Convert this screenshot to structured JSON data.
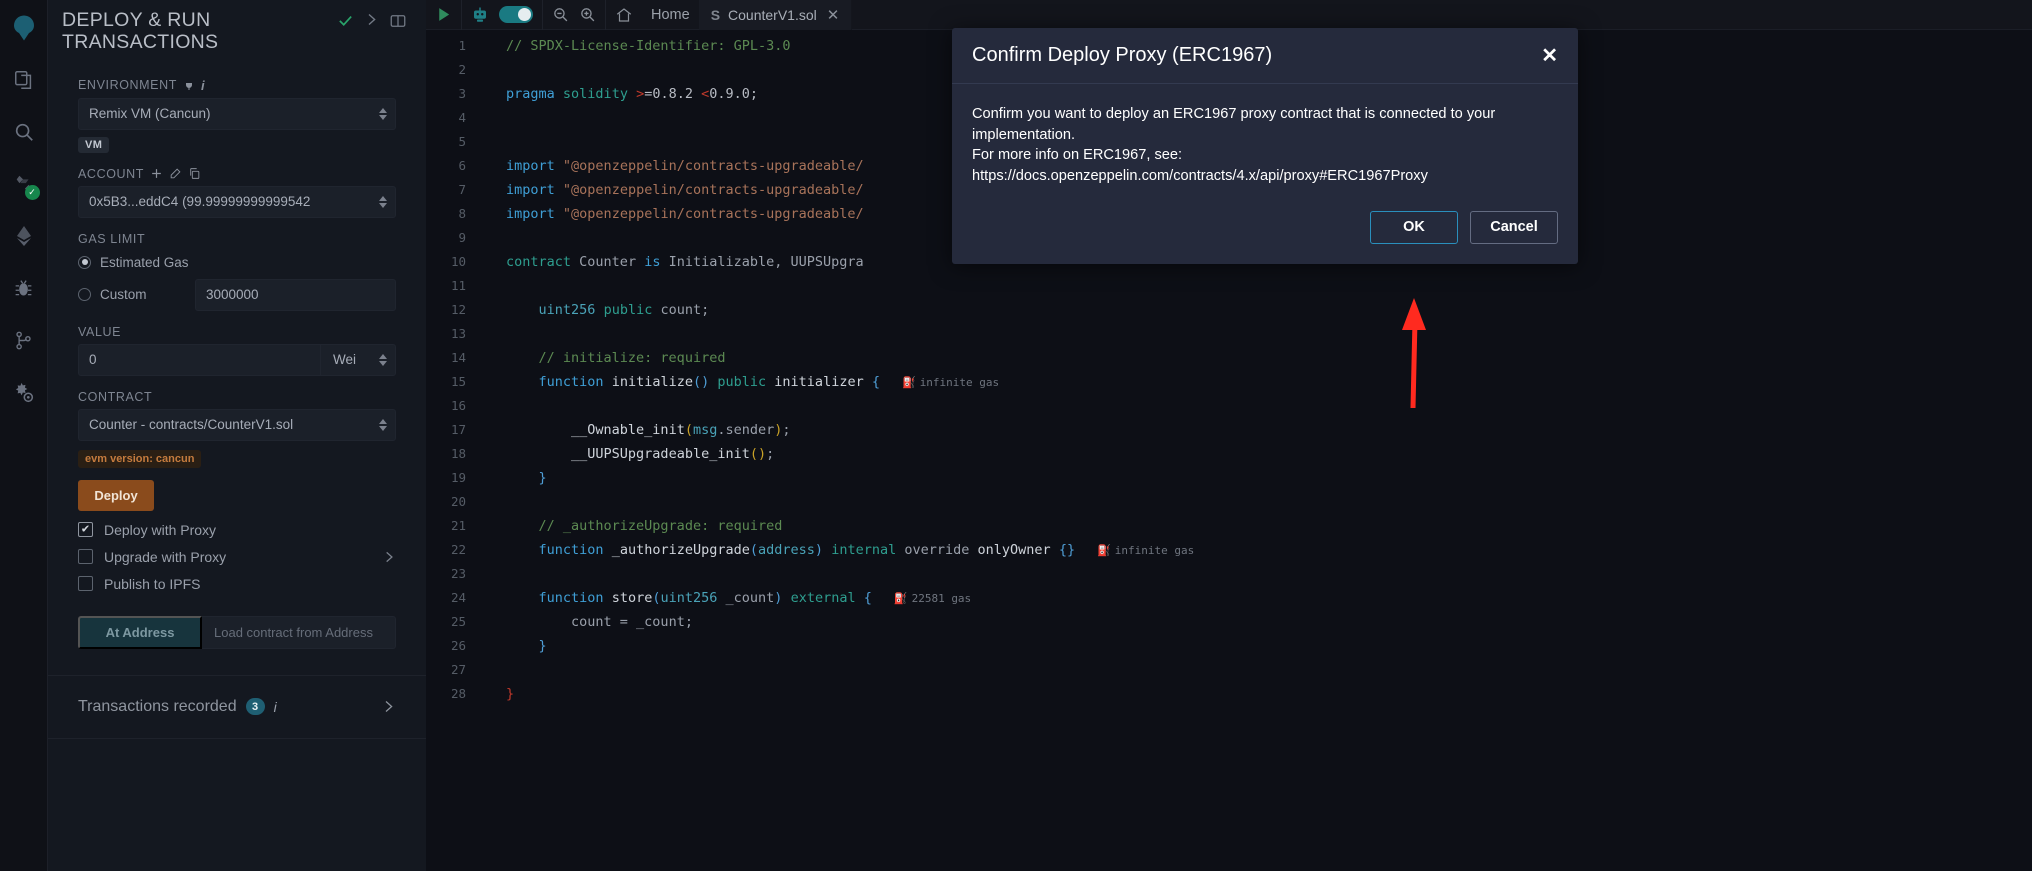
{
  "rail": {
    "items": [
      {
        "name": "remix-logo-icon",
        "label": "Remix"
      },
      {
        "name": "file-explorer-icon",
        "label": "File explorer"
      },
      {
        "name": "search-icon",
        "label": "Search in files"
      },
      {
        "name": "solidity-compiler-icon",
        "label": "Solidity compiler"
      },
      {
        "name": "deploy-run-icon",
        "label": "Deploy & run transactions"
      },
      {
        "name": "debugger-icon",
        "label": "Debugger"
      },
      {
        "name": "git-icon",
        "label": "Git"
      },
      {
        "name": "plugin-manager-icon",
        "label": "Plugin manager"
      }
    ]
  },
  "panel": {
    "title": "DEPLOY & RUN TRANSACTIONS",
    "header_controls": [
      {
        "name": "check-icon",
        "label": "✓"
      },
      {
        "name": "chevron-right-icon",
        "label": "›"
      },
      {
        "name": "layout-panel-icon",
        "label": "▣"
      }
    ],
    "environment": {
      "label": "ENVIRONMENT",
      "value": "Remix VM (Cancun)",
      "chip": "VM"
    },
    "account": {
      "label": "ACCOUNT",
      "value": "0x5B3...eddC4 (99.99999999999542",
      "actions": [
        "plus-icon",
        "edit-icon",
        "copy-icon"
      ]
    },
    "gas_limit": {
      "label": "GAS LIMIT",
      "estimated_label": "Estimated Gas",
      "custom_label": "Custom",
      "custom_value": "3000000",
      "selected": "Estimated Gas"
    },
    "value": {
      "label": "VALUE",
      "amount": "0",
      "unit": "Wei"
    },
    "contract": {
      "label": "CONTRACT",
      "value": "Counter - contracts/CounterV1.sol",
      "evm_chip": "evm version: cancun"
    },
    "deploy_label": "Deploy",
    "options": [
      {
        "label": "Deploy with Proxy",
        "checked": true,
        "chevron": false
      },
      {
        "label": "Upgrade with Proxy",
        "checked": false,
        "chevron": true
      },
      {
        "label": "Publish to IPFS",
        "checked": false,
        "chevron": false
      }
    ],
    "at_address": {
      "button_label": "At Address",
      "placeholder": "Load contract from Address"
    },
    "transactions": {
      "label": "Transactions recorded",
      "count": "3",
      "info": "i",
      "chevron": "›"
    }
  },
  "toolbar": {
    "run_label": "▶",
    "bot_label": "robot",
    "zoom_out_label": "−",
    "zoom_in_label": "+",
    "home_label": "Home"
  },
  "tabs": [
    {
      "label": "CounterV1.sol",
      "icon": "solidity-icon",
      "close": "✕",
      "active": true
    }
  ],
  "code": {
    "lines": [
      {
        "n": "1",
        "segs": [
          {
            "t": "// SPDX-License-Identifier: GPL-3.0",
            "c": "c-comment"
          }
        ]
      },
      {
        "n": "2",
        "segs": []
      },
      {
        "n": "3",
        "segs": [
          {
            "t": "pragma",
            "c": "c-key"
          },
          {
            "t": " ",
            "c": "c-punct"
          },
          {
            "t": "solidity",
            "c": "c-key2"
          },
          {
            "t": " ",
            "c": "c-punct"
          },
          {
            "t": ">",
            "c": "c-red"
          },
          {
            "t": "=0.8.2 ",
            "c": "c-num"
          },
          {
            "t": "<",
            "c": "c-red"
          },
          {
            "t": "0.9.0;",
            "c": "c-num"
          }
        ]
      },
      {
        "n": "4",
        "segs": []
      },
      {
        "n": "5",
        "segs": []
      },
      {
        "n": "6",
        "segs": [
          {
            "t": "import",
            "c": "c-key"
          },
          {
            "t": " ",
            "c": "c-punct"
          },
          {
            "t": "\"@openzeppelin/contracts-upgradeable/",
            "c": "c-str"
          }
        ]
      },
      {
        "n": "7",
        "segs": [
          {
            "t": "import",
            "c": "c-key"
          },
          {
            "t": " ",
            "c": "c-punct"
          },
          {
            "t": "\"@openzeppelin/contracts-upgradeable/",
            "c": "c-str"
          }
        ]
      },
      {
        "n": "8",
        "segs": [
          {
            "t": "import",
            "c": "c-key"
          },
          {
            "t": " ",
            "c": "c-punct"
          },
          {
            "t": "\"@openzeppelin/contracts-upgradeable/",
            "c": "c-str"
          }
        ]
      },
      {
        "n": "9",
        "segs": []
      },
      {
        "n": "10",
        "segs": [
          {
            "t": "contract",
            "c": "c-key2"
          },
          {
            "t": " ",
            "c": "c-punct"
          },
          {
            "t": "Counter",
            "c": "c-ident"
          },
          {
            "t": " ",
            "c": "c-punct"
          },
          {
            "t": "is",
            "c": "c-key"
          },
          {
            "t": " ",
            "c": "c-punct"
          },
          {
            "t": "Initializable, UUPSUpgra",
            "c": "c-ident"
          }
        ]
      },
      {
        "n": "11",
        "segs": []
      },
      {
        "n": "12",
        "segs": [
          {
            "t": "    ",
            "c": "c-punct"
          },
          {
            "t": "uint256",
            "c": "c-teal"
          },
          {
            "t": " ",
            "c": "c-punct"
          },
          {
            "t": "public",
            "c": "c-key2"
          },
          {
            "t": " ",
            "c": "c-punct"
          },
          {
            "t": "count;",
            "c": "c-ident"
          }
        ]
      },
      {
        "n": "13",
        "segs": []
      },
      {
        "n": "14",
        "segs": [
          {
            "t": "    ",
            "c": "c-punct"
          },
          {
            "t": "// initialize: required",
            "c": "c-comment"
          }
        ]
      },
      {
        "n": "15",
        "segs": [
          {
            "t": "    ",
            "c": "c-punct"
          },
          {
            "t": "function",
            "c": "c-key"
          },
          {
            "t": " ",
            "c": "c-punct"
          },
          {
            "t": "initialize",
            "c": "c-fname"
          },
          {
            "t": "()",
            "c": "c-brace"
          },
          {
            "t": " ",
            "c": "c-punct"
          },
          {
            "t": "public",
            "c": "c-key2"
          },
          {
            "t": " ",
            "c": "c-punct"
          },
          {
            "t": "initializer",
            "c": "c-fname"
          },
          {
            "t": " ",
            "c": "c-punct"
          },
          {
            "t": "{",
            "c": "c-brace"
          }
        ],
        "gas": "infinite gas"
      },
      {
        "n": "16",
        "segs": []
      },
      {
        "n": "17",
        "segs": [
          {
            "t": "        ",
            "c": "c-punct"
          },
          {
            "t": "__Ownable_init",
            "c": "c-fname"
          },
          {
            "t": "(",
            "c": "c-yellow"
          },
          {
            "t": "msg",
            "c": "c-teal"
          },
          {
            "t": ".sender",
            "c": "c-ident"
          },
          {
            "t": ")",
            "c": "c-yellow"
          },
          {
            "t": ";",
            "c": "c-ident"
          }
        ]
      },
      {
        "n": "18",
        "segs": [
          {
            "t": "        ",
            "c": "c-punct"
          },
          {
            "t": "__UUPSUpgradeable_init",
            "c": "c-fname"
          },
          {
            "t": "()",
            "c": "c-yellow"
          },
          {
            "t": ";",
            "c": "c-ident"
          }
        ]
      },
      {
        "n": "19",
        "segs": [
          {
            "t": "    ",
            "c": "c-punct"
          },
          {
            "t": "}",
            "c": "c-brace"
          }
        ]
      },
      {
        "n": "20",
        "segs": []
      },
      {
        "n": "21",
        "segs": [
          {
            "t": "    ",
            "c": "c-punct"
          },
          {
            "t": "// _authorizeUpgrade: required",
            "c": "c-comment"
          }
        ]
      },
      {
        "n": "22",
        "segs": [
          {
            "t": "    ",
            "c": "c-punct"
          },
          {
            "t": "function",
            "c": "c-key"
          },
          {
            "t": " ",
            "c": "c-punct"
          },
          {
            "t": "_authorizeUpgrade",
            "c": "c-fname"
          },
          {
            "t": "(",
            "c": "c-brace"
          },
          {
            "t": "address",
            "c": "c-teal"
          },
          {
            "t": ")",
            "c": "c-brace"
          },
          {
            "t": " ",
            "c": "c-punct"
          },
          {
            "t": "internal",
            "c": "c-key2"
          },
          {
            "t": " ",
            "c": "c-punct"
          },
          {
            "t": "override",
            "c": "c-ident"
          },
          {
            "t": " ",
            "c": "c-punct"
          },
          {
            "t": "onlyOwner",
            "c": "c-fname"
          },
          {
            "t": " ",
            "c": "c-punct"
          },
          {
            "t": "{}",
            "c": "c-brace"
          }
        ],
        "gas": "infinite gas"
      },
      {
        "n": "23",
        "segs": []
      },
      {
        "n": "24",
        "segs": [
          {
            "t": "    ",
            "c": "c-punct"
          },
          {
            "t": "function",
            "c": "c-key"
          },
          {
            "t": " ",
            "c": "c-punct"
          },
          {
            "t": "store",
            "c": "c-fname"
          },
          {
            "t": "(",
            "c": "c-brace"
          },
          {
            "t": "uint256",
            "c": "c-teal"
          },
          {
            "t": " _count",
            "c": "c-ident"
          },
          {
            "t": ")",
            "c": "c-brace"
          },
          {
            "t": " ",
            "c": "c-punct"
          },
          {
            "t": "external",
            "c": "c-key2"
          },
          {
            "t": " ",
            "c": "c-punct"
          },
          {
            "t": "{",
            "c": "c-brace"
          }
        ],
        "gas": "22581 gas"
      },
      {
        "n": "25",
        "segs": [
          {
            "t": "        ",
            "c": "c-punct"
          },
          {
            "t": "count = _count;",
            "c": "c-ident"
          }
        ]
      },
      {
        "n": "26",
        "segs": [
          {
            "t": "    ",
            "c": "c-punct"
          },
          {
            "t": "}",
            "c": "c-brace"
          }
        ]
      },
      {
        "n": "27",
        "segs": []
      },
      {
        "n": "28",
        "segs": [
          {
            "t": "}",
            "c": "c-red"
          }
        ]
      }
    ]
  },
  "modal": {
    "title": "Confirm Deploy Proxy (ERC1967)",
    "close_label": "✕",
    "body_line1": "Confirm you want to deploy an ERC1967 proxy contract that is connected to your implementation.",
    "body_line2": "For more info on ERC1967, see:",
    "body_line3": "https://docs.openzeppelin.com/contracts/4.x/api/proxy#ERC1967Proxy",
    "ok_label": "OK",
    "cancel_label": "Cancel"
  },
  "annotation": {
    "arrow_color": "#ff2a1f"
  }
}
